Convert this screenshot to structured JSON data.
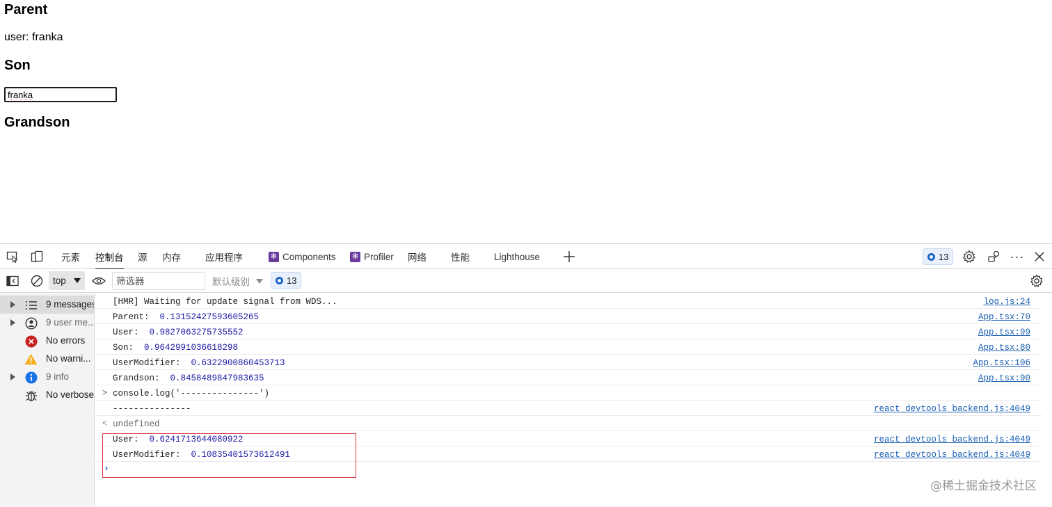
{
  "page": {
    "parent_heading": "Parent",
    "user_line": "user: franka",
    "son_heading": "Son",
    "son_input_value": "franka",
    "grandson_heading": "Grandson"
  },
  "devtools": {
    "tabs": [
      {
        "label": "元素",
        "active": false
      },
      {
        "label": "控制台",
        "active": true
      },
      {
        "label": "源",
        "active": false
      },
      {
        "label": "内存",
        "active": false
      },
      {
        "label": "应用程序",
        "active": false
      },
      {
        "label": "Components",
        "active": false,
        "icon": "react-icon"
      },
      {
        "label": "Profiler",
        "active": false,
        "icon": "react-icon"
      },
      {
        "label": "网络",
        "active": false
      },
      {
        "label": "性能",
        "active": false
      },
      {
        "label": "Lighthouse",
        "active": false
      }
    ],
    "issues_badge": "13",
    "toolbar": {
      "context": "top",
      "filter_placeholder": "筛选器",
      "levels_label": "默认级别",
      "issues_count": "13"
    },
    "sidebar": [
      {
        "label": "9 messages",
        "icon": "list-icon",
        "expandable": true,
        "selected": true
      },
      {
        "label": "9 user me...",
        "icon": "user-icon",
        "expandable": true,
        "selected": false
      },
      {
        "label": "No errors",
        "icon": "error-icon",
        "expandable": false,
        "selected": false
      },
      {
        "label": "No warni...",
        "icon": "warning-icon",
        "expandable": false,
        "selected": false
      },
      {
        "label": "9 info",
        "icon": "info-icon",
        "expandable": true,
        "selected": false
      },
      {
        "label": "No verbose",
        "icon": "bug-icon",
        "expandable": false,
        "selected": false
      }
    ],
    "console_rows": [
      {
        "text": "[HMR] Waiting for update signal from WDS...",
        "value": "",
        "source": "log.js:24"
      },
      {
        "text": "Parent:  ",
        "value": "0.13152427593605265",
        "source": "App.tsx:70"
      },
      {
        "text": "User:  ",
        "value": "0.9827063275735552",
        "source": "App.tsx:99"
      },
      {
        "text": "Son:  ",
        "value": "0.9642991036618298",
        "source": "App.tsx:80"
      },
      {
        "text": "UserModifier:  ",
        "value": "0.6322900860453713",
        "source": "App.tsx:106"
      },
      {
        "text": "Grandson:  ",
        "value": "0.8458489847983635",
        "source": "App.tsx:90"
      },
      {
        "text": "console.log('---------------')",
        "value": "",
        "source": "",
        "gutter": ">"
      },
      {
        "text": "---------------",
        "value": "",
        "source": "react_devtools_backend.js:4049"
      },
      {
        "text": "undefined",
        "value": "",
        "source": "",
        "gutter": "<"
      },
      {
        "text": "User:  ",
        "value": "0.6241713644080922",
        "source": "react_devtools_backend.js:4049"
      },
      {
        "text": "UserModifier:  ",
        "value": "0.10835401573612491",
        "source": "react_devtools_backend.js:4049"
      }
    ],
    "prompt": "›"
  },
  "watermark": "@稀土掘金技术社区",
  "colors": {
    "highlight_border": "#d9363e",
    "number_blue": "#1a1aa6",
    "link_blue": "#1a5fb4",
    "error_red": "#c5221f",
    "warning_yellow": "#f2b01e",
    "info_blue": "#1a73e8"
  }
}
